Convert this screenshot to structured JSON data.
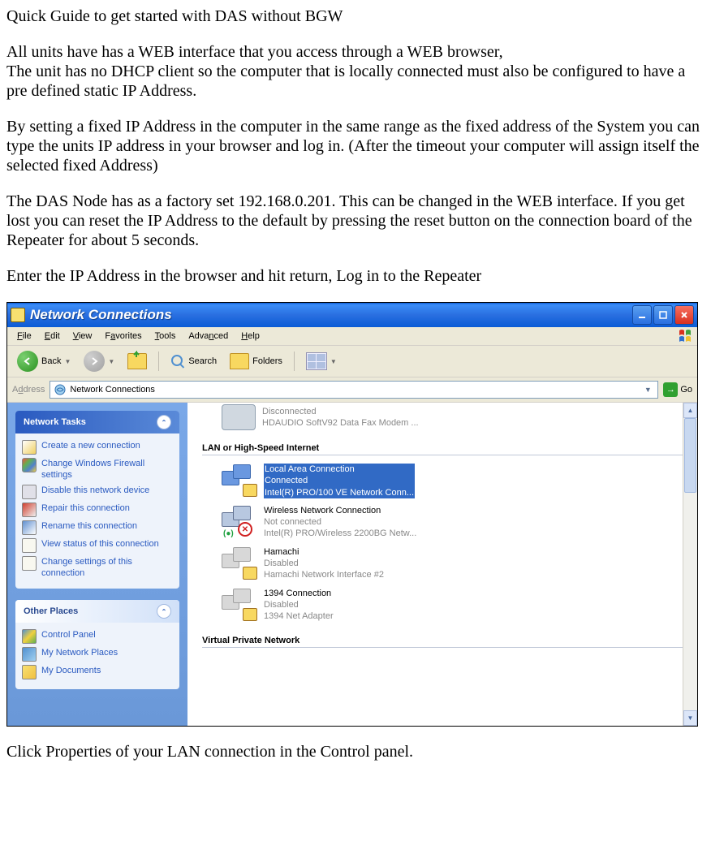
{
  "doc": {
    "title": "Quick Guide to get started with DAS without BGW",
    "para1": "All units have has a WEB interface that you access through a WEB browser,",
    "para1b": "The unit has no DHCP client so the computer that is locally connected must also be configured to have a pre defined static IP Address.",
    "para2": "By setting a fixed IP Address in the computer in the same range as the fixed  address of the System you can type the units IP address in your browser and log in. (After the timeout your computer will assign itself the selected fixed Address)",
    "para3": "The DAS Node has as a factory set 192.168.0.201. This can be changed in the WEB interface. If you get lost you can reset the IP Address to the default by pressing the reset button on the connection board of the Repeater for about 5 seconds.",
    "para4": "Enter the IP Address in the browser and hit return, Log in to the Repeater",
    "para5": "Click Properties of your LAN connection in the Control panel."
  },
  "window": {
    "title": "Network Connections",
    "menus": [
      "File",
      "Edit",
      "View",
      "Favorites",
      "Tools",
      "Advanced",
      "Help"
    ],
    "toolbar": {
      "back": "Back",
      "search": "Search",
      "folders": "Folders"
    },
    "address": {
      "label": "Address",
      "value": "Network Connections",
      "go": "Go"
    },
    "sidebar": {
      "networkTasks": {
        "title": "Network Tasks",
        "items": [
          "Create a new connection",
          "Change Windows Firewall settings",
          "Disable this network device",
          "Repair this connection",
          "Rename this connection",
          "View status of this connection",
          "Change settings of this connection"
        ]
      },
      "otherPlaces": {
        "title": "Other Places",
        "items": [
          "Control Panel",
          "My Network Places",
          "My Documents"
        ]
      }
    },
    "content": {
      "dialup": {
        "name": "Disconnected",
        "status": "HDAUDIO SoftV92 Data Fax Modem ..."
      },
      "section1": "LAN or High-Speed Internet",
      "lan": {
        "name": "Local Area Connection",
        "status": "Connected",
        "device": "Intel(R) PRO/100 VE Network Conn..."
      },
      "wireless": {
        "name": "Wireless Network Connection",
        "status": "Not connected",
        "device": "Intel(R) PRO/Wireless 2200BG Netw..."
      },
      "hamachi": {
        "name": "Hamachi",
        "status": "Disabled",
        "device": "Hamachi Network Interface #2"
      },
      "ieee1394": {
        "name": "1394 Connection",
        "status": "Disabled",
        "device": "1394 Net Adapter"
      },
      "section2": "Virtual Private Network"
    }
  }
}
